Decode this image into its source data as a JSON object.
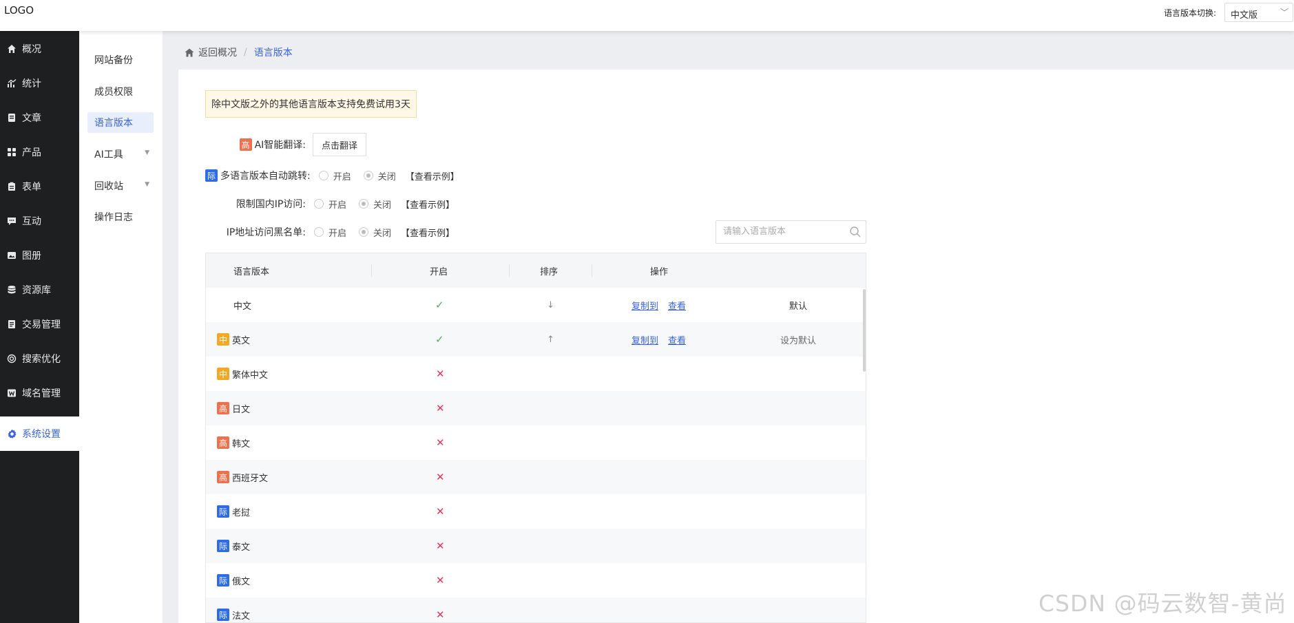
{
  "header": {
    "logo": "LOGO",
    "lang_switch_label": "语言版本切换:",
    "lang_select_value": "中文版"
  },
  "sidebar": {
    "items": [
      {
        "label": "概况",
        "icon": "home-icon"
      },
      {
        "label": "统计",
        "icon": "chart-icon"
      },
      {
        "label": "文章",
        "icon": "document-icon"
      },
      {
        "label": "产品",
        "icon": "grid-icon"
      },
      {
        "label": "表单",
        "icon": "clipboard-icon"
      },
      {
        "label": "互动",
        "icon": "chat-icon"
      },
      {
        "label": "图册",
        "icon": "image-icon"
      },
      {
        "label": "资源库",
        "icon": "database-icon"
      },
      {
        "label": "交易管理",
        "icon": "receipt-icon"
      },
      {
        "label": "搜索优化",
        "icon": "target-icon"
      },
      {
        "label": "域名管理",
        "icon": "w-icon"
      },
      {
        "label": "系统设置",
        "icon": "gear-icon"
      }
    ]
  },
  "subnav": {
    "items": [
      {
        "label": "网站备份"
      },
      {
        "label": "成员权限"
      },
      {
        "label": "语言版本"
      },
      {
        "label": "AI工具"
      },
      {
        "label": "回收站"
      },
      {
        "label": "操作日志"
      }
    ]
  },
  "breadcrumb": {
    "back": "返回概况",
    "sep": "/",
    "current": "语言版本"
  },
  "notice": "除中文版之外的其他语言版本支持免费试用3天",
  "form": {
    "ai_translate": {
      "tag": "高",
      "label": "AI智能翻译:",
      "button": "点击翻译"
    },
    "auto_jump": {
      "tag": "际",
      "label": "多语言版本自动跳转:"
    },
    "restrict_ip": {
      "label": "限制国内IP访问:"
    },
    "ip_blacklist": {
      "label": "IP地址访问黑名单:"
    },
    "on": "开启",
    "off": "关闭",
    "example": "【查看示例】"
  },
  "search": {
    "placeholder": "请输入语言版本"
  },
  "table": {
    "headers": {
      "language": "语言版本",
      "enabled": "开启",
      "sort": "排序",
      "actions": "操作"
    },
    "copy_to": "复制到",
    "view": "查看",
    "rows": [
      {
        "tag": "",
        "name": "中文",
        "enabled": "✓",
        "sort": "↓",
        "status": "默认"
      },
      {
        "tag": "中",
        "name": "英文",
        "enabled": "✓",
        "sort": "↑",
        "status": "设为默认"
      },
      {
        "tag": "中",
        "name": "繁体中文",
        "enabled": "✕"
      },
      {
        "tag": "高",
        "name": "日文",
        "enabled": "✕"
      },
      {
        "tag": "高",
        "name": "韩文",
        "enabled": "✕"
      },
      {
        "tag": "高",
        "name": "西班牙文",
        "enabled": "✕"
      },
      {
        "tag": "际",
        "name": "老挝",
        "enabled": "✕"
      },
      {
        "tag": "际",
        "name": "泰文",
        "enabled": "✕"
      },
      {
        "tag": "际",
        "name": "俄文",
        "enabled": "✕"
      },
      {
        "tag": "际",
        "name": "法文",
        "enabled": "✕"
      }
    ]
  },
  "watermark": "CSDN @码云数智-黄尚",
  "colors": {
    "accent": "#3a63e0",
    "sidebar_bg": "#1e1f21",
    "tag_gao": "#f0704e",
    "tag_ji": "#2e6be6",
    "tag_zhong": "#f5a623",
    "check": "#4caf50",
    "cross": "#e8345a"
  }
}
